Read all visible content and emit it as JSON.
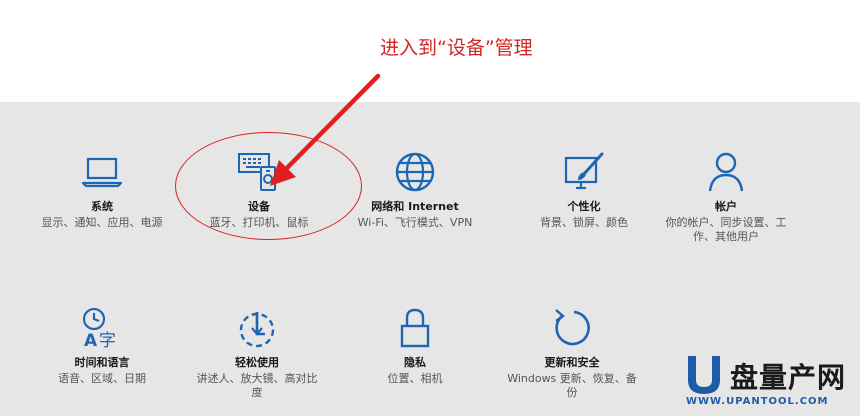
{
  "annotation": {
    "text": "进入到“设备”管理",
    "color": "#d42424"
  },
  "colors": {
    "icon_blue": "#1e66b4",
    "panel_bg": "#e6e6e6"
  },
  "tiles": [
    {
      "icon": "laptop-icon",
      "title": "系统",
      "desc": "显示、通知、应用、电源"
    },
    {
      "icon": "keyboard-device-icon",
      "title": "设备",
      "desc": "蓝牙、打印机、鼠标"
    },
    {
      "icon": "globe-icon",
      "title": "网络和 Internet",
      "desc": "Wi-Fi、飞行模式、VPN"
    },
    {
      "icon": "paint-screen-icon",
      "title": "个性化",
      "desc": "背景、锁屏、颜色"
    },
    {
      "icon": "person-icon",
      "title": "帐户",
      "desc": "你的帐户、同步设置、工作、其他用户"
    },
    {
      "icon": "time-language-icon",
      "title": "时间和语言",
      "desc": "语音、区域、日期"
    },
    {
      "icon": "ease-of-access-icon",
      "title": "轻松使用",
      "desc": "讲述人、放大镜、高对比度"
    },
    {
      "icon": "lock-icon",
      "title": "隐私",
      "desc": "位置、相机"
    },
    {
      "icon": "refresh-icon",
      "title": "更新和安全",
      "desc": "Windows 更新、恢复、备份"
    }
  ],
  "watermark": {
    "title": "盘量产网",
    "url": "WWW.UPANTOOL.COM"
  }
}
